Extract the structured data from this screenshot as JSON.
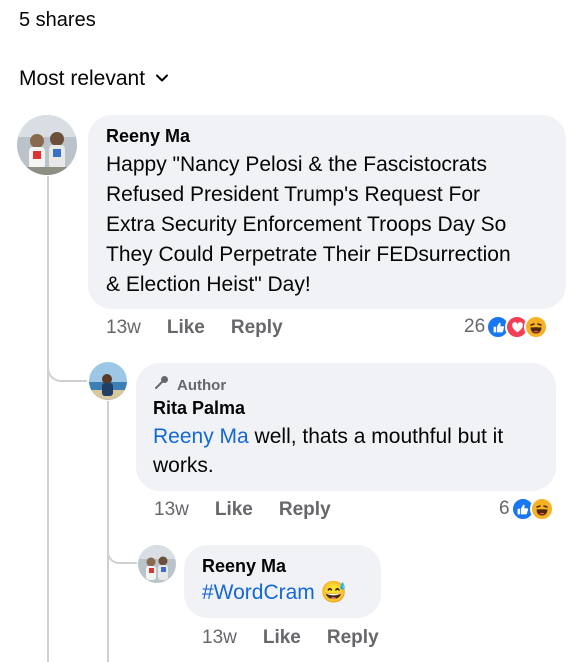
{
  "header": {
    "shares": "5 shares",
    "sort_label": "Most relevant"
  },
  "comments": [
    {
      "author": "Reeny Ma",
      "lines": [
        "Happy \"Nancy Pelosi & the Fascistocrats",
        "Refused President Trump's Request For",
        "Extra Security Enforcement Troops Day So",
        "They Could Perpetrate Their FEDsurrection",
        "& Election Heist\" Day!"
      ],
      "time": "13w",
      "like": "Like",
      "reply": "Reply",
      "reaction_count": "26",
      "reactions": [
        "like-reaction-icon",
        "love-reaction-icon",
        "haha-reaction-icon"
      ]
    },
    {
      "badge": "Author",
      "author": "Rita Palma",
      "mention": "Reeny Ma",
      "line1_rest": " well, thats a mouthful but it",
      "line2": "works.",
      "time": "13w",
      "like": "Like",
      "reply": "Reply",
      "reaction_count": "6",
      "reactions": [
        "like-reaction-icon",
        "haha-reaction-icon"
      ]
    },
    {
      "author": "Reeny Ma",
      "hashtag": "#WordCram",
      "emoji": "😅",
      "time": "13w",
      "like": "Like",
      "reply": "Reply"
    }
  ],
  "colors": {
    "link": "#1467d6",
    "bubble": "#f0f2f5",
    "like_blue": "#1877f2",
    "love_red": "#f33e58",
    "haha_yellow": "#f7b125"
  }
}
